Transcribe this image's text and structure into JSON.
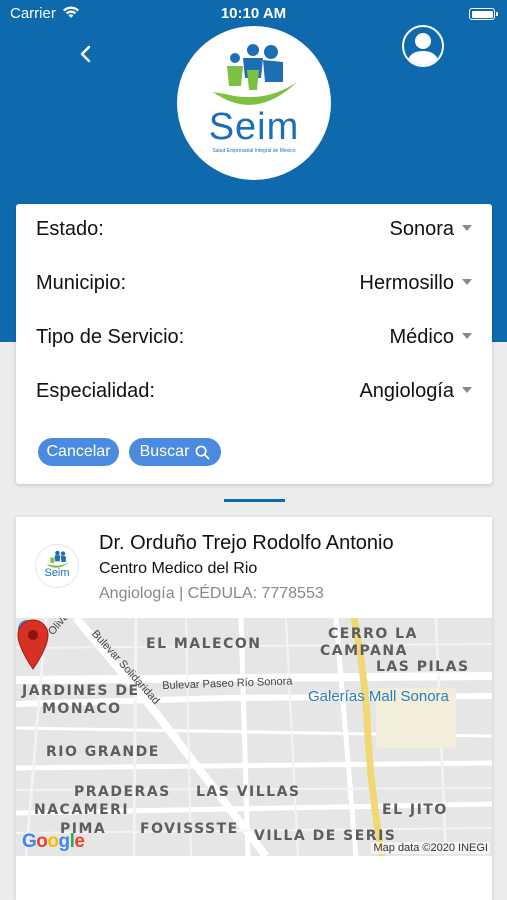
{
  "status_bar": {
    "carrier": "Carrier",
    "time": "10:10 AM"
  },
  "header": {
    "logo": {
      "text": "Seim",
      "subtitle": "Salud Empresarial Integral de México"
    }
  },
  "filters": [
    {
      "label": "Estado:",
      "value": "Sonora"
    },
    {
      "label": "Municipio:",
      "value": "Hermosillo"
    },
    {
      "label": "Tipo de Servicio:",
      "value": "Médico"
    },
    {
      "label": "Especialidad:",
      "value": "Angiología"
    }
  ],
  "actions": {
    "cancel_label": "Cancelar",
    "search_label": "Buscar"
  },
  "result": {
    "avatar_text": "Seim",
    "doctor_name": "Dr. Orduño Trejo Rodolfo Antonio",
    "clinic": "Centro Medico del Rio",
    "specialty_line": "Angiología | CÉDULA: 7778553"
  },
  "map": {
    "labels": {
      "el_malecon": "EL MALECON",
      "cerro_la_campana_1": "CERRO LA",
      "cerro_la_campana_2": "CAMPANA",
      "las_pilas": "LAS PILAS",
      "jardines_1": "JARDINES DE",
      "jardines_2": "MONACO",
      "rio_grande": "RIO GRANDE",
      "praderas": "PRADERAS",
      "las_villas": "LAS VILLAS",
      "nacameri": "NACAMERI",
      "el_jito": "EL JITO",
      "pima": "PIMA",
      "fovissste": "FOVISSSTE",
      "villa_de_seris": "VILLA DE SERIS",
      "olivares": "Olivares",
      "bulevar_solidaridad": "Bulevar Solidaridad",
      "bulevar_paseo": "Bulevar Paseo Río Sonora"
    },
    "poi": "Galerías Mall Sonora",
    "google": "Google",
    "attribution": "Map data ©2020 INEGI"
  },
  "colors": {
    "header_bg": "#0e6aad",
    "button_bg": "#4a8be0",
    "pin_red": "#d93025"
  }
}
